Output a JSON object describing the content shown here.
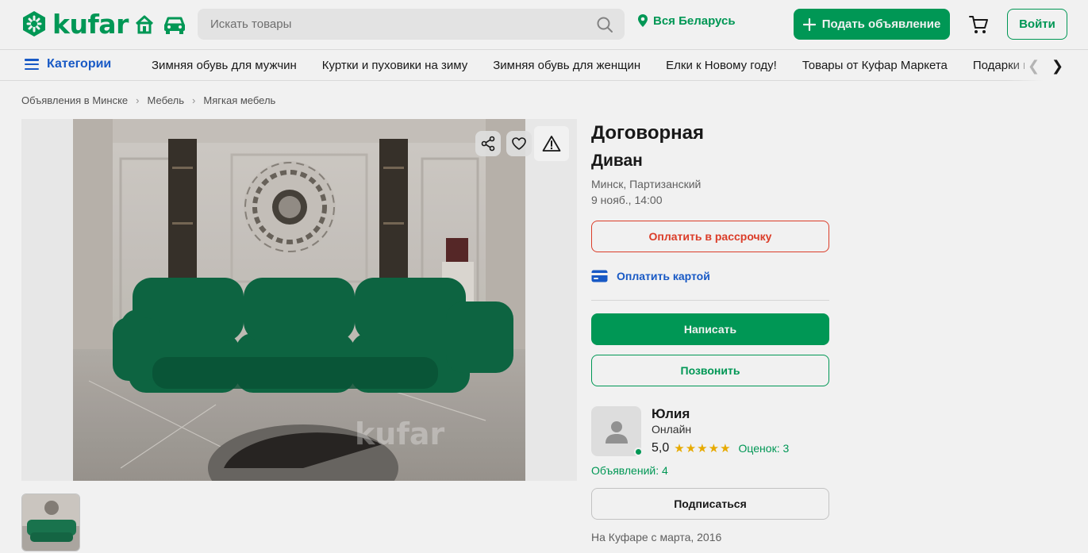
{
  "header": {
    "logo_text": "kufar",
    "search_placeholder": "Искать товары",
    "region": "Вся Беларусь",
    "post_ad_label": "Подать объявление",
    "login_label": "Войти",
    "icons": [
      "home-icon",
      "car-icon",
      "search-icon",
      "location-pin-icon",
      "plus-icon",
      "cart-icon"
    ]
  },
  "categories": {
    "toggle_label": "Категории",
    "links": [
      "Зимняя обувь для мужчин",
      "Куртки и пуховики на зиму",
      "Зимняя обувь для женщин",
      "Елки к Новому году!",
      "Товары от Куфар Маркета",
      "Подарки к"
    ]
  },
  "breadcrumb": [
    "Объявления в Минске",
    "Мебель",
    "Мягкая мебель"
  ],
  "gallery": {
    "watermark": "kufar",
    "icons": [
      "share-icon",
      "heart-icon",
      "warning-icon"
    ]
  },
  "ad": {
    "price": "Договорная",
    "title": "Диван",
    "location": "Минск, Партизанский",
    "date": "9 нояб., 14:00",
    "installment_label": "Оплатить в рассрочку",
    "card_pay_label": "Оплатить картой",
    "write_label": "Написать",
    "call_label": "Позвонить"
  },
  "seller": {
    "name": "Юлия",
    "status": "Онлайн",
    "rating": "5,0",
    "stars": 5,
    "reviews": "Оценок: 3",
    "ads_count": "Объявлений: 4",
    "subscribe_label": "Подписаться",
    "since": "На Куфаре с марта, 2016"
  },
  "colors": {
    "brand_green": "#00a05a",
    "link_blue": "#1a5fd1",
    "installment_red": "#e8412c",
    "star_yellow": "#f5b400"
  }
}
